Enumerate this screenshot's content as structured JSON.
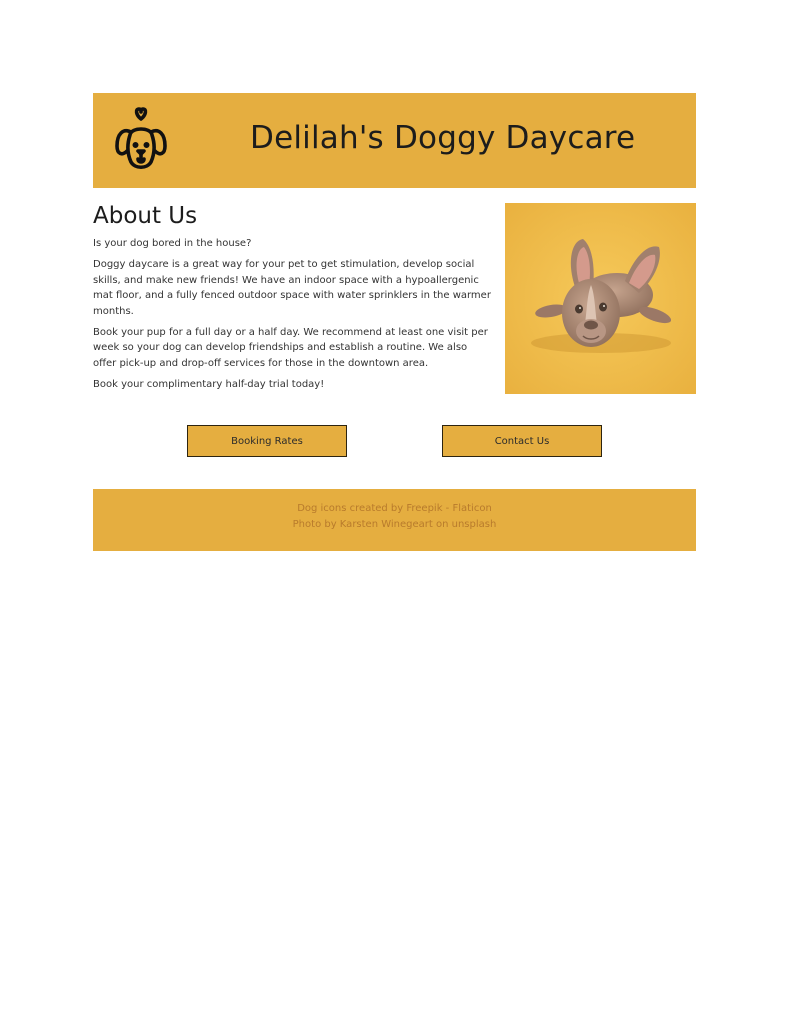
{
  "header": {
    "title": "Delilah's Doggy Daycare",
    "logo_icon": "dog-heart-icon",
    "background": "#e5ae40"
  },
  "about": {
    "heading": "About Us",
    "paragraphs": [
      "Is your dog bored in the house?",
      "Doggy daycare is a great way for your pet to get stimulation, develop social skills, and make new friends! We have an indoor space with a hypoallergenic mat floor, and a fully fenced outdoor space with water sprinklers in the warmer months.",
      "Book your pup for a full day or a half day. We recommend at least one visit per week so your dog can develop friendships and establish a routine. We also offer pick-up and drop-off services for those in the downtown area.",
      "Book your complimentary half-day trial today!"
    ]
  },
  "photo": {
    "alt": "French bulldog puppy lying on a yellow background"
  },
  "buttons": {
    "booking_label": "Booking Rates",
    "contact_label": "Contact Us"
  },
  "footer": {
    "credit_line_1": "Dog icons created by Freepik - Flaticon",
    "credit_line_2": "Photo by Karsten Winegeart on unsplash"
  }
}
